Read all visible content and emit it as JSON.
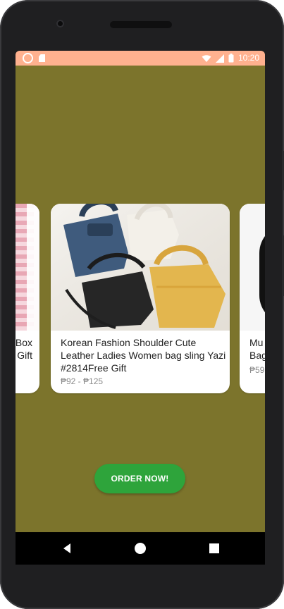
{
  "status_bar": {
    "time": "10:20",
    "icons": [
      "circle-icon",
      "sim-icon",
      "wifi-icon",
      "signal-icon",
      "battery-icon"
    ]
  },
  "carousel": {
    "left_card": {
      "title": "Box\nGift",
      "price": ""
    },
    "main_card": {
      "title": "Korean Fashion Shoulder Cute\nLeather Ladies Women bag sling Yazi\n#2814Free Gift",
      "price": "₱92 - ₱125"
    },
    "right_card": {
      "title": "Mu\nBag",
      "price": "₱59"
    }
  },
  "cta": {
    "label": "ORDER NOW!"
  },
  "colors": {
    "background": "#7c742c",
    "status_bar": "#ffb18f",
    "button": "#2ea43b"
  },
  "nav": {
    "icons": [
      "back-icon",
      "home-icon",
      "recents-icon"
    ]
  }
}
